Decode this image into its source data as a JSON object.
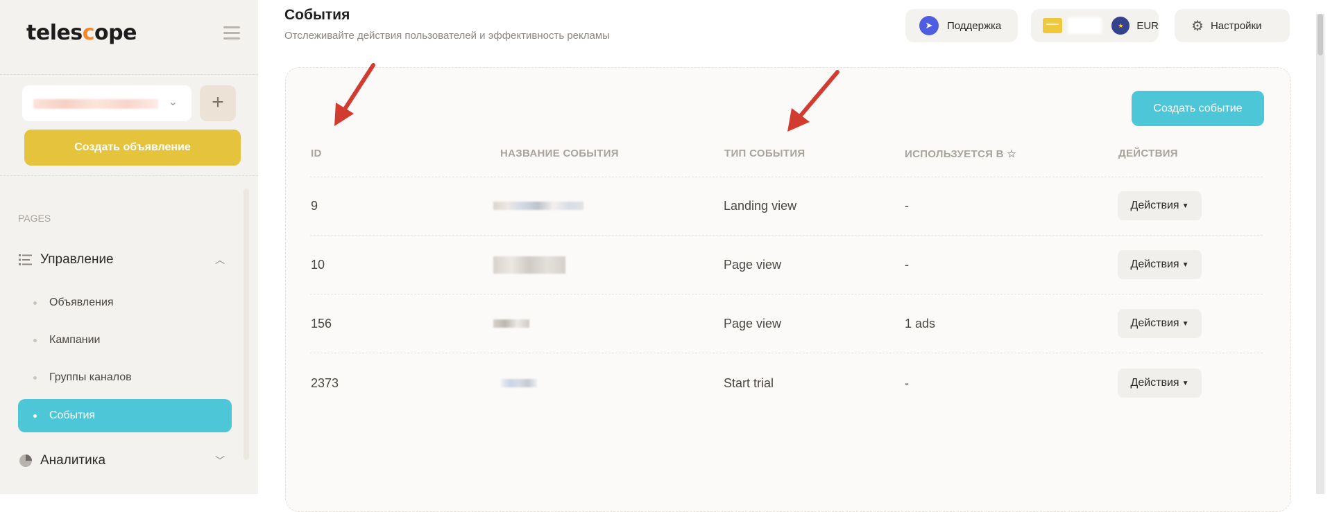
{
  "sidebar": {
    "logo_pre": "teles",
    "logo_o": "c",
    "logo_post": "ope",
    "create_ad_label": "Создать объявление",
    "add_label": "+",
    "pages_label": "PAGES",
    "groups": [
      {
        "label": "Управление",
        "icon": "list-icon",
        "chevron": "⌃"
      },
      {
        "label": "Аналитика",
        "icon": "pie-chart-icon",
        "chevron": "⌄"
      }
    ],
    "items": [
      {
        "label": "Объявления"
      },
      {
        "label": "Кампании"
      },
      {
        "label": "Группы каналов"
      },
      {
        "label": "События",
        "active": true
      }
    ]
  },
  "header": {
    "title": "События",
    "subtitle": "Отслеживайте действия пользователей и эффективность рекламы",
    "support_label": "Поддержка",
    "currency": "EUR",
    "settings_label": "Настройки"
  },
  "events": {
    "create_label": "Создать событие",
    "columns": {
      "id": "ID",
      "name": "НАЗВАНИЕ СОБЫТИЯ",
      "type": "ТИП СОБЫТИЯ",
      "used": "ИСПОЛЬЗУЕТСЯ В ☆",
      "actions": "ДЕЙСТВИЯ"
    },
    "rows": [
      {
        "id": "9",
        "type": "Landing view",
        "used": "-",
        "actions": "Действия"
      },
      {
        "id": "10",
        "type": "Page view",
        "used": "-",
        "actions": "Действия"
      },
      {
        "id": "156",
        "type": "Page view",
        "used": "1 ads",
        "actions": "Действия"
      },
      {
        "id": "2373",
        "type": "Start trial",
        "used": "-",
        "actions": "Действия"
      }
    ]
  },
  "colors": {
    "accent": "#4dc6d8",
    "primary_yellow": "#e6c33c",
    "arrow_red": "#d23b2f"
  }
}
